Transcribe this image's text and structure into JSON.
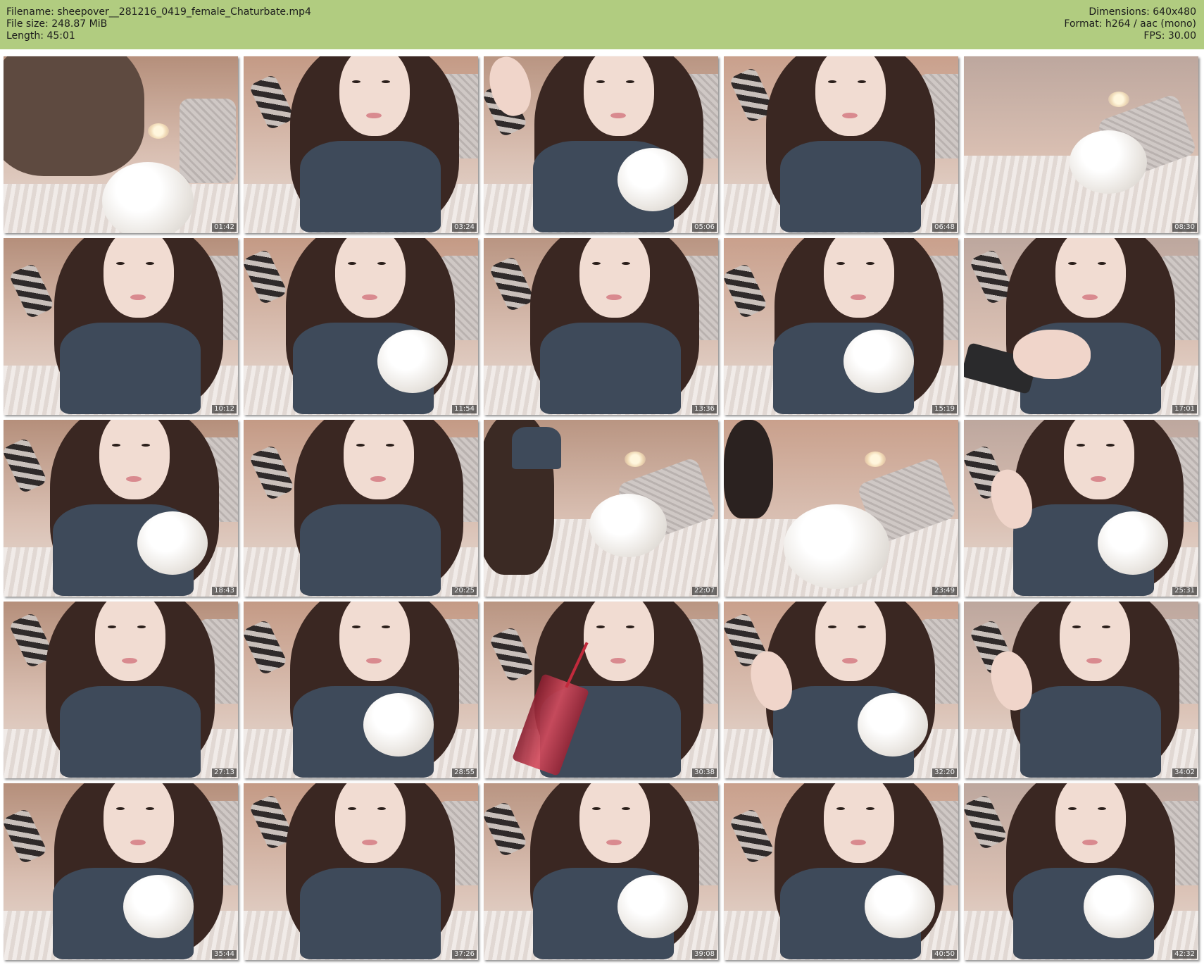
{
  "header": {
    "filename": "Filename: sheepover__281216_0419_female_Chaturbate.mp4",
    "file_size": "File size: 248.87 MiB",
    "length": "Length: 45:01",
    "dimensions": "Dimensions: 640x480",
    "format": "Format: h264 / aac (mono)",
    "fps": "FPS: 30.00"
  },
  "colors": {
    "header_bg": "#b1cc80",
    "page_bg": "#ffffff"
  },
  "thumbnails": [
    {
      "timestamp": "01:42"
    },
    {
      "timestamp": "03:24"
    },
    {
      "timestamp": "05:06"
    },
    {
      "timestamp": "06:48"
    },
    {
      "timestamp": "08:30"
    },
    {
      "timestamp": "10:12"
    },
    {
      "timestamp": "11:54"
    },
    {
      "timestamp": "13:36"
    },
    {
      "timestamp": "15:19"
    },
    {
      "timestamp": "17:01"
    },
    {
      "timestamp": "18:43"
    },
    {
      "timestamp": "20:25"
    },
    {
      "timestamp": "22:07"
    },
    {
      "timestamp": "23:49"
    },
    {
      "timestamp": "25:31"
    },
    {
      "timestamp": "27:13"
    },
    {
      "timestamp": "28:55"
    },
    {
      "timestamp": "30:38"
    },
    {
      "timestamp": "32:20"
    },
    {
      "timestamp": "34:02"
    },
    {
      "timestamp": "35:44"
    },
    {
      "timestamp": "37:26"
    },
    {
      "timestamp": "39:08"
    },
    {
      "timestamp": "40:50"
    },
    {
      "timestamp": "42:32"
    }
  ]
}
